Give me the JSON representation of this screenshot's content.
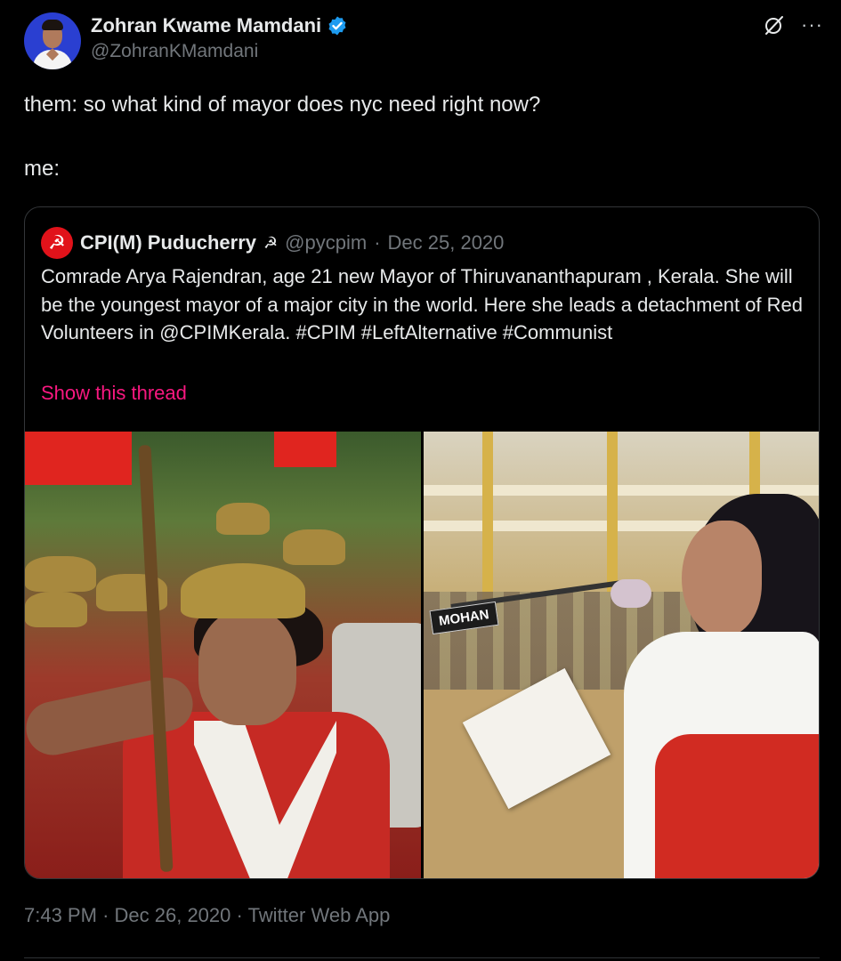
{
  "author": {
    "display_name": "Zohran Kwame Mamdani",
    "handle": "@ZohranKMamdani",
    "verified": true,
    "avatar": "avatar-photo"
  },
  "header_actions": {
    "grok_icon": "grok-icon",
    "more_label": "···"
  },
  "tweet": {
    "text": "them: so what kind of mayor does nyc need right now?\n\nme:"
  },
  "quote": {
    "display_name": "CPI(M) Puducherry",
    "hammer_sickle": "☭",
    "handle": "@pycpim",
    "separator": "·",
    "date": "Dec 25, 2020",
    "text": "Comrade Arya Rajendran, age 21  new Mayor of Thiruvananthapuram , Kerala. She will be the youngest mayor of a major city in the world. Here she leads a detachment of Red Volunteers in @CPIMKerala. #CPIM  #LeftAlternative #Communist",
    "show_thread": "Show this thread",
    "media": [
      {
        "name": "photo-red-volunteers",
        "label": ""
      },
      {
        "name": "photo-council-speech",
        "label": "MOHAN"
      }
    ]
  },
  "meta": {
    "time": "7:43 PM",
    "separator": "·",
    "date": "Dec 26, 2020",
    "separator2": "·",
    "source": "Twitter Web App"
  },
  "colors": {
    "background": "#000000",
    "text": "#e7e9ea",
    "muted": "#71767b",
    "link_pink": "#f91880",
    "verified_blue": "#1d9bf0",
    "border": "#333639"
  }
}
